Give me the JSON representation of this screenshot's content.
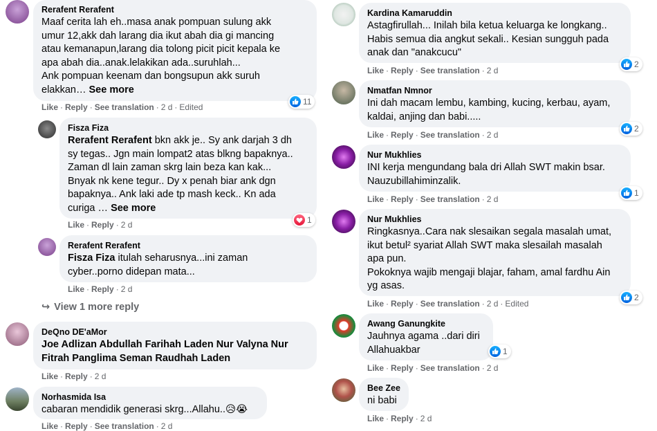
{
  "colors": {
    "bubble": "#f0f2f5",
    "meta": "#65676b",
    "like_blue": "#0a7cff",
    "love_red": "#f33e58"
  },
  "left": [
    {
      "author": "Rerafent Rerafent",
      "text": "Maaf cerita lah eh..masa anak pompuan sulung akk\numur 12,akk dah larang dia ikut abah dia gi mancing\natau kemanapun,larang dia tolong picit picit kepala ke\napa abah dia..anak.lelakikan ada..suruhlah...\nAnk pompuan keenam dan bongsupun akk suruh\nelakkan…",
      "see_more": "See more",
      "actions": [
        "Like",
        "Reply",
        "See translation"
      ],
      "time": "2 d",
      "edited": "Edited",
      "reaction": {
        "icon": "like-icon",
        "count": "11"
      }
    },
    {
      "author": "Fisza Fiza",
      "tag": "Rerafent Rerafent",
      "text": " bkn akk je.. Sy ank darjah 3 dh\nsy tegas.. Jgn main lompat2 atas blkng bapaknya..\nZaman dl lain zaman skrg lain beza kan kak...\nBnyak nk kene tegur.. Dy x penah biar ank dgn\nbapaknya.. Ank laki ade tp mash keck.. Kn ada\ncuriga …",
      "see_more": "See more",
      "actions": [
        "Like",
        "Reply"
      ],
      "time": "2 d",
      "reaction": {
        "icon": "love-icon",
        "count": "1"
      }
    },
    {
      "author": "Rerafent Rerafent",
      "tag": "Fisza Fiza",
      "text": " itulah seharusnya...ini zaman\ncyber..porno didepan mata...",
      "actions": [
        "Like",
        "Reply"
      ],
      "time": "2 d"
    },
    {
      "view_more": "View 1 more reply"
    },
    {
      "author": "DeQno DE'aMor",
      "tag": "Joe Adlizan Abdullah Farihah Laden Nur Valyna Nur\nFitrah Panglima Seman Raudhah Laden",
      "text": "",
      "actions": [
        "Like",
        "Reply"
      ],
      "time": "2 d"
    },
    {
      "author": "Norhasmida Isa",
      "text": "cabaran mendidik generasi skrg...Allahu..😥😭",
      "actions": [
        "Like",
        "Reply",
        "See translation"
      ],
      "time": "2 d"
    }
  ],
  "right": [
    {
      "author": "Kardina Kamaruddin",
      "text": "Astagfirullah... Inilah bila ketua keluarga ke longkang..\nHabis semua dia angkut sekali.. Kesian sungguh pada\nanak dan \"anakcucu\"",
      "actions": [
        "Like",
        "Reply",
        "See translation"
      ],
      "time": "2 d",
      "reaction": {
        "icon": "like-icon",
        "count": "2"
      }
    },
    {
      "author": "Nmatfan Nmnor",
      "text": "Ini dah macam lembu, kambing, kucing, kerbau, ayam,\nkaldai, anjing dan babi.....",
      "actions": [
        "Like",
        "Reply",
        "See translation"
      ],
      "time": "2 d",
      "reaction": {
        "icon": "like-icon",
        "count": "2"
      }
    },
    {
      "author": "Nur Mukhlies",
      "text": "INI kerja mengundang bala dri Allah SWT makin bsar.\nNauzubillahiminzalik.",
      "actions": [
        "Like",
        "Reply",
        "See translation"
      ],
      "time": "2 d",
      "reaction": {
        "icon": "like-icon",
        "count": "1"
      }
    },
    {
      "author": "Nur Mukhlies",
      "text": "Ringkasnya..Cara nak slesaikan segala masalah umat,\nikut betul² syariat Allah SWT maka slesailah masalah\napa pun.\nPokoknya wajib mengaji blajar, faham, amal fardhu Ain\nyg asas.",
      "actions": [
        "Like",
        "Reply",
        "See translation"
      ],
      "time": "2 d",
      "edited": "Edited",
      "reaction": {
        "icon": "like-icon",
        "count": "2"
      }
    },
    {
      "author": "Awang Ganungkite",
      "text": "Jauhnya agama ..dari diri\nAllahuakbar",
      "actions": [
        "Like",
        "Reply",
        "See translation"
      ],
      "time": "2 d",
      "reaction": {
        "icon": "like-icon",
        "count": "1"
      }
    },
    {
      "author": "Bee Zee",
      "text": "ni babi",
      "actions": [
        "Like",
        "Reply"
      ],
      "time": "2 d"
    }
  ]
}
